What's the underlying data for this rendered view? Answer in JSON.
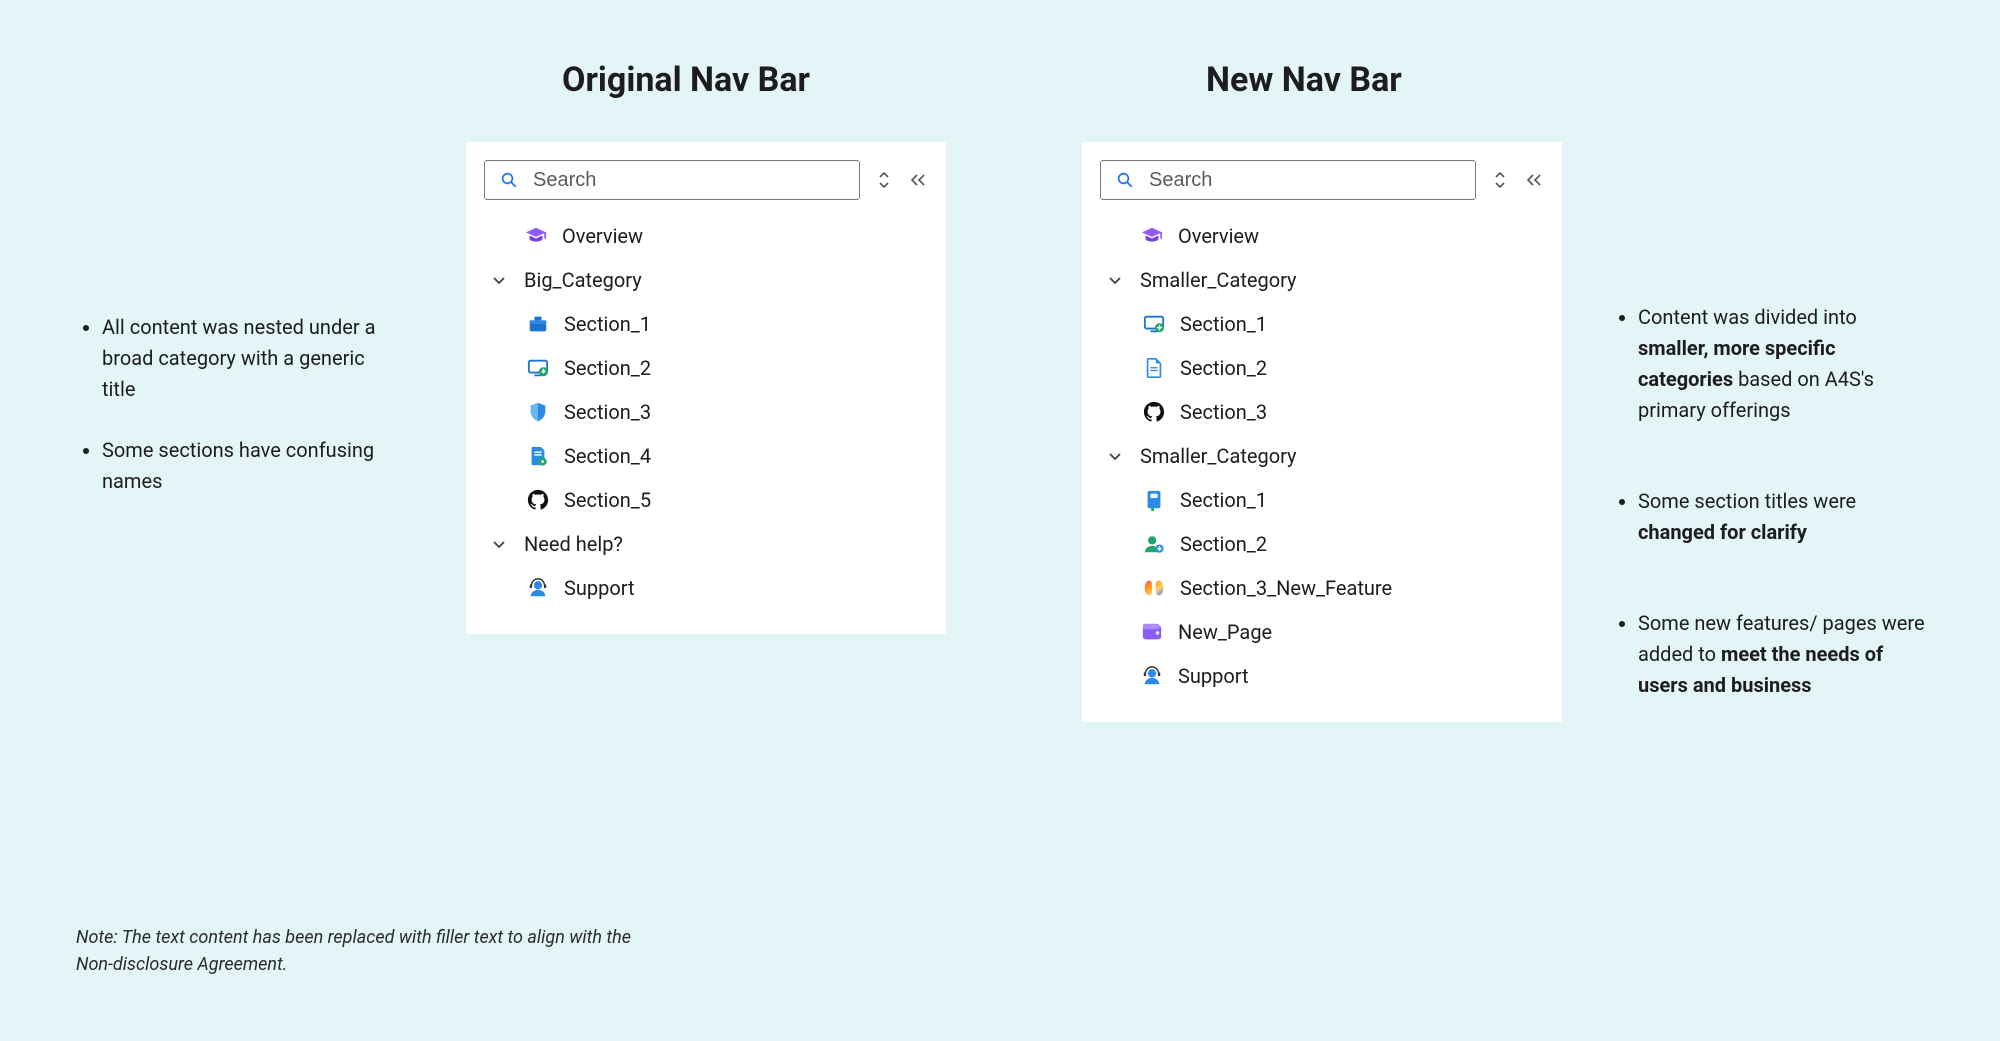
{
  "titles": {
    "original": "Original Nav Bar",
    "new": "New Nav Bar"
  },
  "search": {
    "placeholder": "Search"
  },
  "original_nav": {
    "overview": "Overview",
    "big_category": "Big_Category",
    "sections": [
      "Section_1",
      "Section_2",
      "Section_3",
      "Section_4",
      "Section_5"
    ],
    "need_help": "Need help?",
    "support": "Support"
  },
  "new_nav": {
    "overview": "Overview",
    "cat1": "Smaller_Category",
    "cat1_sections": [
      "Section_1",
      "Section_2",
      "Section_3"
    ],
    "cat2": "Smaller_Category",
    "cat2_sections": [
      "Section_1",
      "Section_2",
      "Section_3_New_Feature"
    ],
    "new_page": "New_Page",
    "support": "Support"
  },
  "left_notes": {
    "b1": "All content was nested under a broad category with a generic title",
    "b2": "Some sections have confusing names"
  },
  "right_notes": {
    "b1_pre": "Content was divided into ",
    "b1_strong": "smaller, more specific categories",
    "b1_post": " based on A4S's primary offerings",
    "b2_pre": "Some section titles were ",
    "b2_strong": "changed for clarify",
    "b3_pre": "Some new features/ pages were added to ",
    "b3_strong": "meet the needs of users and business"
  },
  "footnote": "Note: The text content has been replaced with filler text to align with the Non-disclosure Agreement."
}
